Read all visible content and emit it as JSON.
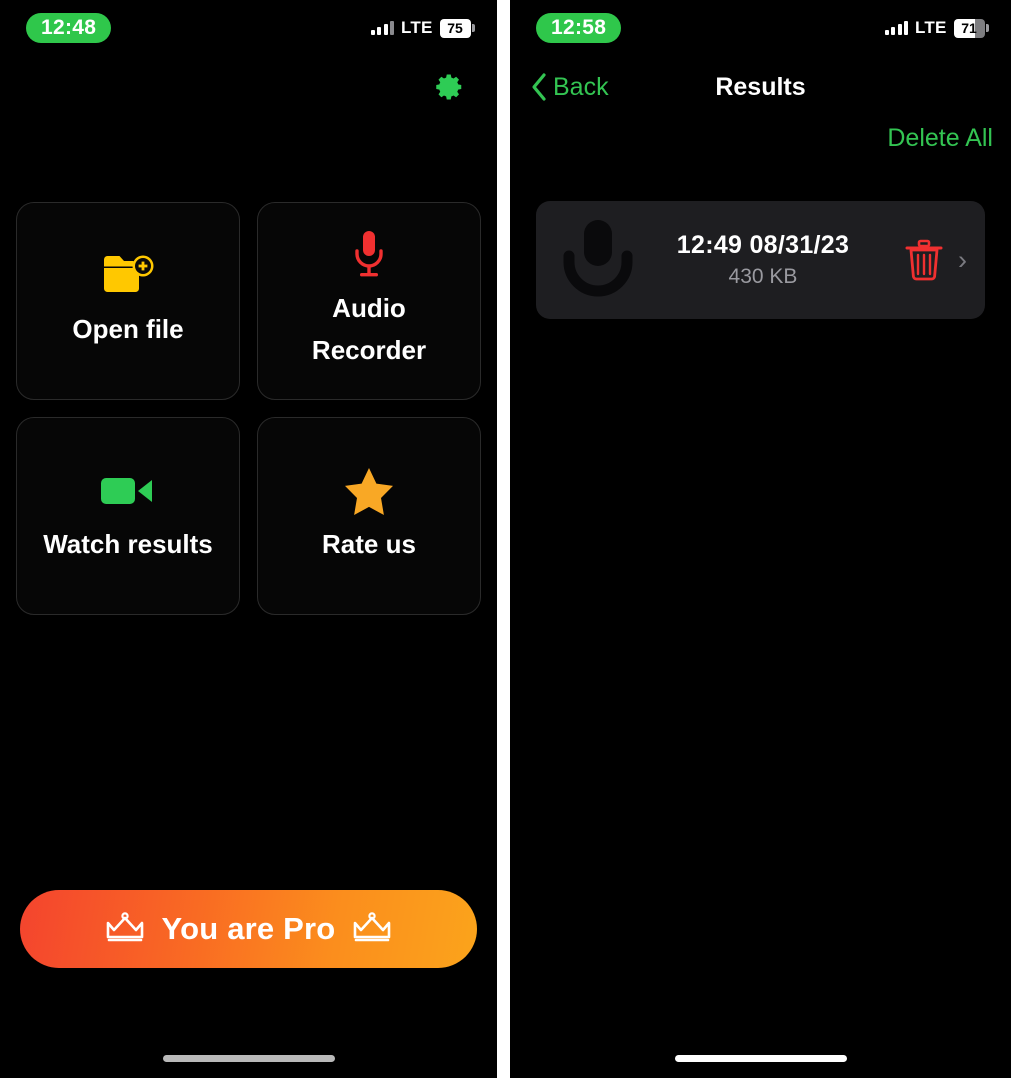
{
  "left": {
    "status": {
      "time": "12:48",
      "network": "LTE",
      "battery": "75"
    },
    "settings_icon": "gear-icon",
    "tiles": [
      {
        "label": "Open file",
        "icon": "folder-add-icon",
        "color": "#FFC800"
      },
      {
        "label": "Audio Recorder",
        "icon": "microphone-icon",
        "color": "#F03030"
      },
      {
        "label": "Watch results",
        "icon": "video-camera-icon",
        "color": "#2ECC55"
      },
      {
        "label": "Rate us",
        "icon": "star-icon",
        "color": "#F9A825"
      }
    ],
    "pro_button": {
      "label": "You are Pro",
      "left_icon": "crown-icon",
      "right_icon": "crown-icon",
      "gradient_from": "#F4442E",
      "gradient_to": "#FBA41B"
    }
  },
  "right": {
    "status": {
      "time": "12:58",
      "network": "LTE",
      "battery": "71"
    },
    "nav": {
      "back_label": "Back",
      "back_icon": "chevron-left-icon",
      "title": "Results",
      "delete_all_label": "Delete All",
      "accent": "#33C452"
    },
    "recordings": [
      {
        "icon": "microphone-icon",
        "title": "12:49  08/31/23",
        "size": "430 KB",
        "delete_icon": "trash-icon",
        "chevron": "›"
      }
    ]
  }
}
